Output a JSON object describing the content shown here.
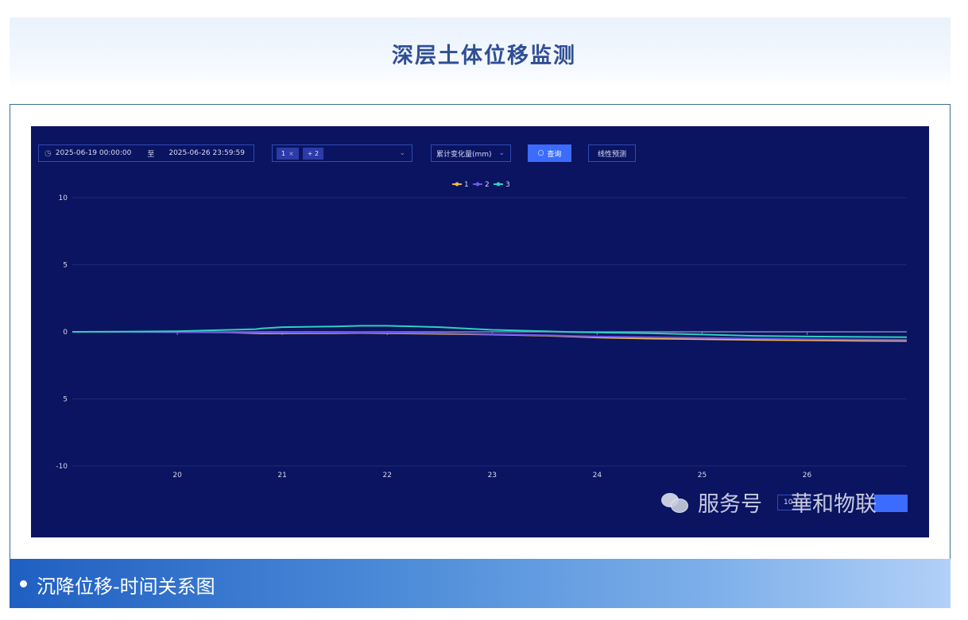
{
  "header": {
    "title": "深层土体位移监测"
  },
  "toolbar": {
    "start_time": "2025-06-19 00:00:00",
    "to_label": "至",
    "end_time": "2025-06-26 23:59:59",
    "selected_tag": "1",
    "more_tags": "+ 2",
    "metric": "累计变化量(mm)",
    "query_label": "查询",
    "predict_label": "线性预测",
    "page_size": "10"
  },
  "watermark": {
    "channel": "服务号",
    "brand": "華和物联"
  },
  "footer": {
    "caption": "沉降位移-时间关系图"
  },
  "chart_data": {
    "type": "line",
    "x_labels": [
      "20",
      "21",
      "22",
      "23",
      "24",
      "25",
      "26"
    ],
    "xlim": [
      19.0,
      26.95
    ],
    "ylim": [
      -10,
      10
    ],
    "y_ticks": [
      10,
      5,
      0,
      -5,
      -10
    ],
    "y_tick_labels": [
      "10",
      "5",
      "0",
      "5",
      "-10"
    ],
    "legend_position": "top-center",
    "grid": true,
    "x": [
      19.0,
      19.5,
      20.0,
      20.5,
      20.75,
      20.8,
      21.0,
      21.5,
      21.75,
      22.0,
      22.5,
      23.0,
      23.5,
      23.75,
      24.0,
      24.5,
      25.0,
      25.5,
      26.0,
      26.5,
      26.95
    ],
    "series": [
      {
        "name": "1",
        "color": "#f0b64c",
        "values": [
          0.0,
          0.0,
          -0.02,
          -0.05,
          -0.1,
          -0.12,
          -0.12,
          -0.1,
          -0.08,
          -0.1,
          -0.15,
          -0.2,
          -0.28,
          -0.35,
          -0.42,
          -0.5,
          -0.55,
          -0.6,
          -0.63,
          -0.66,
          -0.68
        ]
      },
      {
        "name": "2",
        "color": "#6b57e8",
        "values": [
          0.0,
          0.0,
          -0.02,
          -0.03,
          -0.05,
          -0.06,
          -0.07,
          -0.06,
          -0.05,
          -0.06,
          -0.1,
          -0.18,
          -0.25,
          -0.3,
          -0.35,
          -0.4,
          -0.45,
          -0.5,
          -0.55,
          -0.58,
          -0.6
        ]
      },
      {
        "name": "3",
        "color": "#2fd0c0",
        "values": [
          0.0,
          0.02,
          0.05,
          0.15,
          0.2,
          0.25,
          0.35,
          0.4,
          0.45,
          0.45,
          0.35,
          0.15,
          0.05,
          -0.02,
          -0.05,
          -0.1,
          -0.2,
          -0.3,
          -0.35,
          -0.38,
          -0.4
        ]
      }
    ]
  }
}
